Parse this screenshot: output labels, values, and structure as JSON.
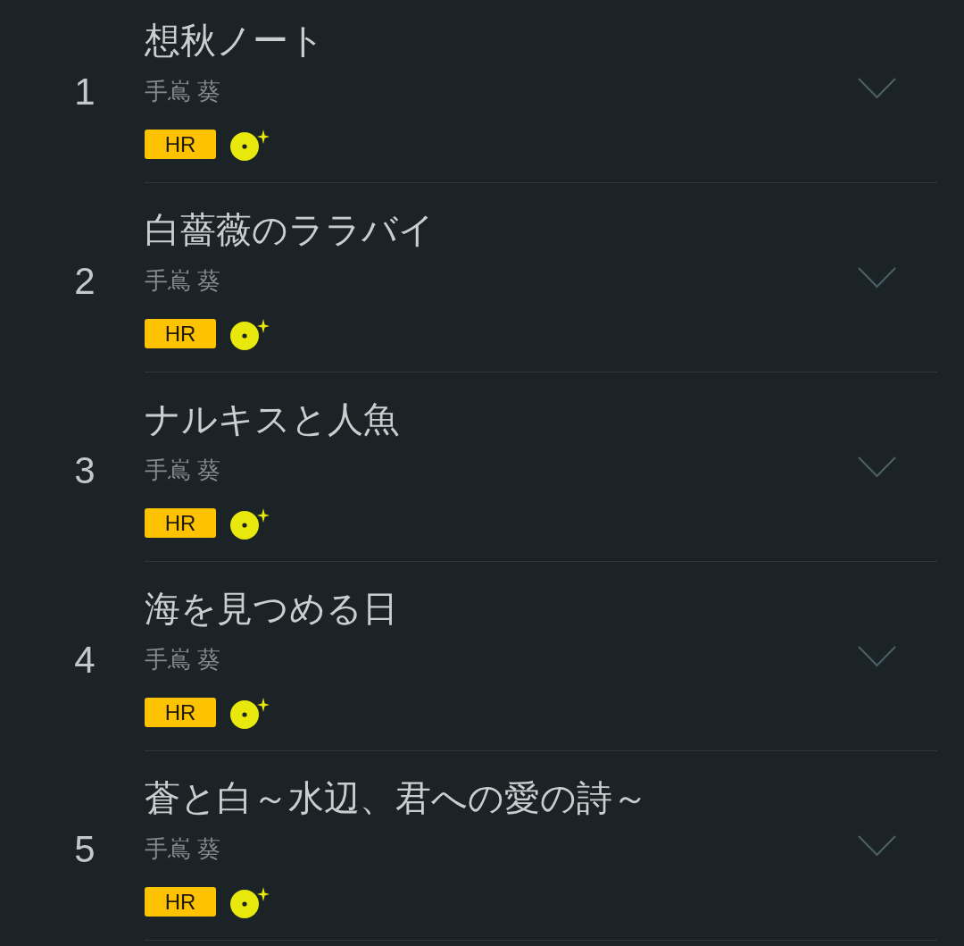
{
  "tracks": [
    {
      "number": "1",
      "title": "想秋ノート",
      "artist": "手嶌 葵",
      "badge": "HR",
      "expanded": false
    },
    {
      "number": "2",
      "title": "白薔薇のララバイ",
      "artist": "手嶌 葵",
      "badge": "HR",
      "expanded": false
    },
    {
      "number": "3",
      "title": "ナルキスと人魚",
      "artist": "手嶌 葵",
      "badge": "HR",
      "expanded": false
    },
    {
      "number": "4",
      "title": "海を見つめる日",
      "artist": "手嶌 葵",
      "badge": "HR",
      "expanded": false
    },
    {
      "number": "5",
      "title": "蒼と白～水辺、君への愛の詩～",
      "artist": "手嶌 葵",
      "badge": "HR",
      "expanded": false
    }
  ]
}
